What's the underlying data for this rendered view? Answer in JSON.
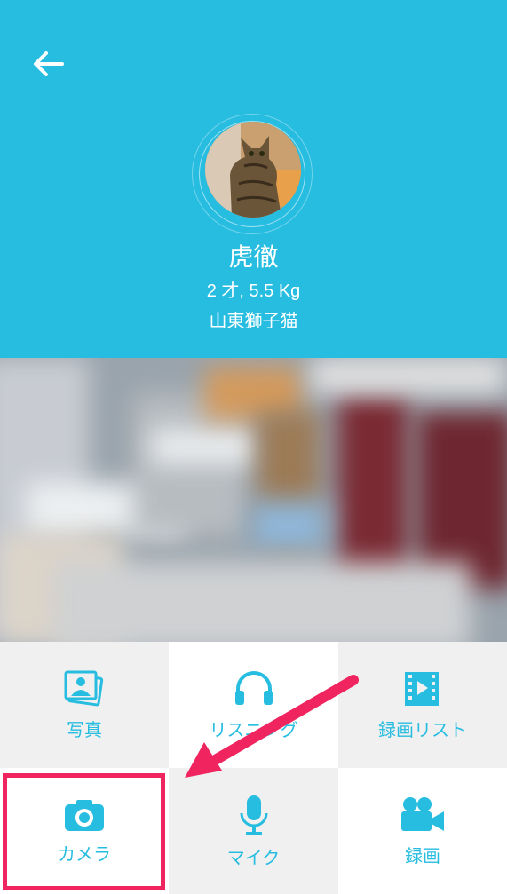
{
  "header": {
    "back_icon": "arrow-left-icon",
    "pet_name": "虎徹",
    "pet_meta": "2 才, 5.5 Kg",
    "pet_breed": "山東獅子猫",
    "bg_color": "#27bde0"
  },
  "controls": [
    {
      "label": "写真",
      "icon": "photos-icon"
    },
    {
      "label": "リスニング",
      "icon": "headphones-icon"
    },
    {
      "label": "録画リスト",
      "icon": "video-list-icon"
    },
    {
      "label": "カメラ",
      "icon": "camera-icon"
    },
    {
      "label": "マイク",
      "icon": "microphone-icon"
    },
    {
      "label": "録画",
      "icon": "video-camera-icon"
    }
  ],
  "colors": {
    "accent": "#27bde0",
    "highlight": "#f0245f"
  }
}
